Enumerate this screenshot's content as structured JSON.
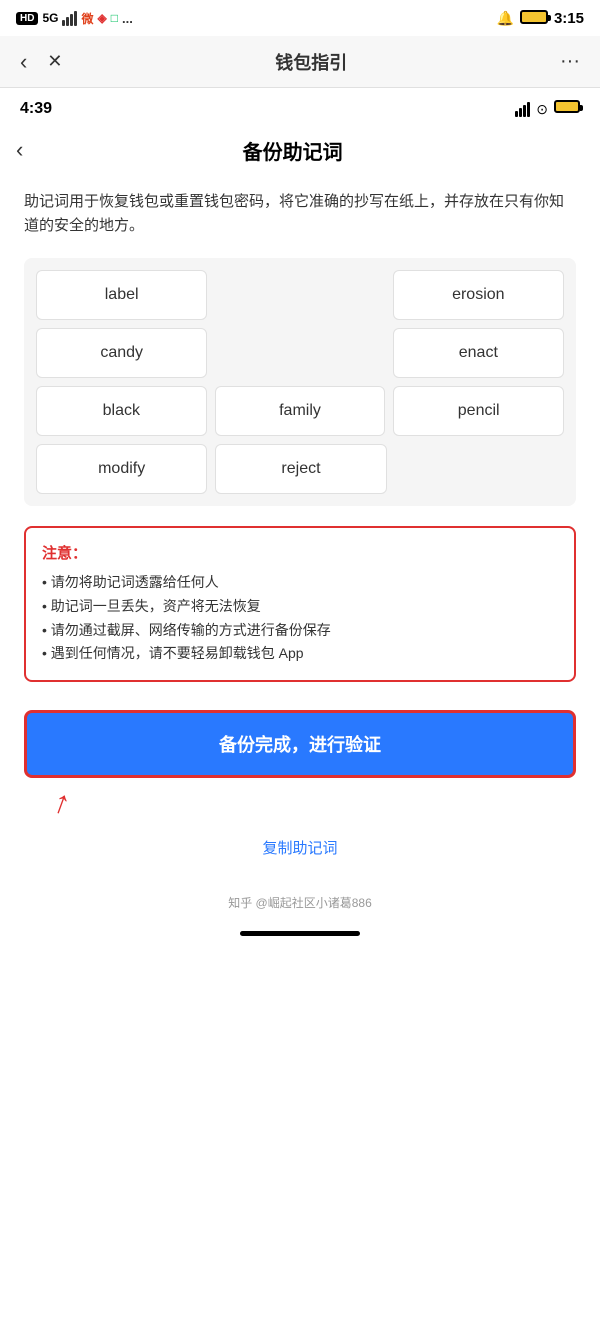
{
  "outer_status": {
    "time": "3:15",
    "hd_badge": "HD",
    "signal_5g": "5G",
    "more_dots": "..."
  },
  "outer_appbar": {
    "back_label": "‹",
    "close_label": "✕",
    "title": "钱包指引",
    "more_label": "···"
  },
  "inner_status": {
    "time": "4:39"
  },
  "inner_nav": {
    "back_label": "‹",
    "title": "备份助记词"
  },
  "description": "助记词用于恢复钱包或重置钱包密码，将它准确的抄写在纸上，并存放在只有你知道的安全的地方。",
  "mnemonic": {
    "words": [
      [
        "label",
        "",
        "erosion"
      ],
      [
        "candy",
        "",
        "enact"
      ],
      [
        "black",
        "family",
        "pencil"
      ],
      [
        "modify",
        "reject",
        ""
      ]
    ]
  },
  "warning": {
    "title": "注意：",
    "items": [
      "• 请勿将助记词透露给任何人",
      "• 助记词一旦丢失，资产将无法恢复",
      "• 请勿通过截屏、网络传输的方式进行备份保存",
      "• 遇到任何情况，请不要轻易卸载钱包 App"
    ]
  },
  "verify_button": {
    "label": "备份完成，进行验证"
  },
  "copy_link": {
    "label": "复制助记词"
  },
  "watermark": "知乎 @崛起社区小诸葛886"
}
